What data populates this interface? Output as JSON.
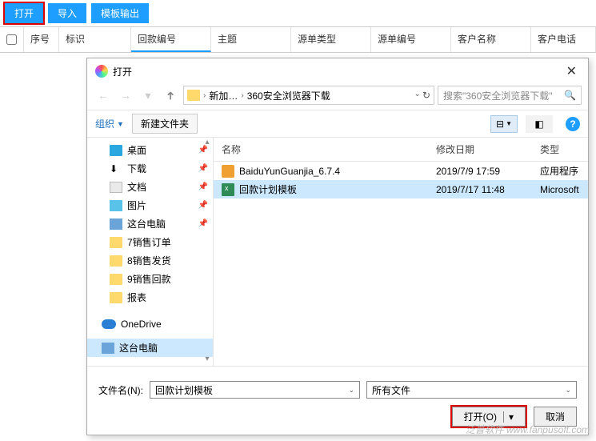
{
  "toolbar": {
    "open": "打开",
    "import": "导入",
    "template_out": "模板输出"
  },
  "columns": {
    "seq": "序号",
    "mark": "标识",
    "code": "回款编号",
    "subject": "主题",
    "src_type": "源单类型",
    "src_code": "源单编号",
    "cust_name": "客户名称",
    "cust_phone": "客户电话"
  },
  "dialog": {
    "title": "打开",
    "crumb1": "新加…",
    "crumb2": "360安全浏览器下载",
    "search_placeholder": "搜索\"360安全浏览器下载\"",
    "organize": "组织",
    "new_folder": "新建文件夹",
    "tree": [
      {
        "icon": "desktop",
        "label": "桌面",
        "pinned": true
      },
      {
        "icon": "download",
        "label": "下载",
        "pinned": true
      },
      {
        "icon": "doc",
        "label": "文档",
        "pinned": true
      },
      {
        "icon": "pic",
        "label": "图片",
        "pinned": true
      },
      {
        "icon": "pc",
        "label": "这台电脑",
        "pinned": true
      },
      {
        "icon": "folder",
        "label": "7销售订单"
      },
      {
        "icon": "folder",
        "label": "8销售发货"
      },
      {
        "icon": "folder",
        "label": "9销售回款"
      },
      {
        "icon": "folder",
        "label": "报表"
      },
      {
        "icon": "cloud",
        "label": "OneDrive"
      },
      {
        "icon": "pc",
        "label": "这台电脑",
        "selected": true
      }
    ],
    "headers": {
      "name": "名称",
      "date": "修改日期",
      "type": "类型"
    },
    "files": [
      {
        "icon": "exe",
        "name": "BaiduYunGuanjia_6.7.4",
        "date": "2019/7/9 17:59",
        "type": "应用程序"
      },
      {
        "icon": "xls",
        "name": "回款计划模板",
        "date": "2019/7/17 11:48",
        "type": "Microsoft",
        "selected": true
      }
    ],
    "filename_label": "文件名(N):",
    "filename_value": "回款计划模板",
    "filetype_value": "所有文件",
    "open_btn": "打开(O)",
    "cancel_btn": "取消"
  },
  "watermark": "泛普软件 www.fanpusoft.com"
}
